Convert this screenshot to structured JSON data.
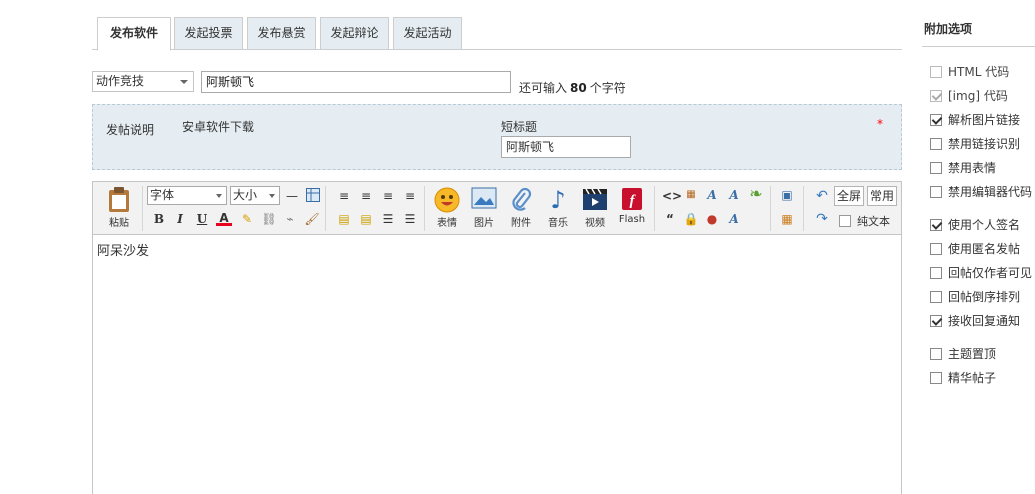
{
  "tabs": [
    {
      "label": "发布软件",
      "active": true
    },
    {
      "label": "发起投票",
      "active": false
    },
    {
      "label": "发布悬赏",
      "active": false
    },
    {
      "label": "发起辩论",
      "active": false
    },
    {
      "label": "发起活动",
      "active": false
    }
  ],
  "subject": {
    "category": "动作竞技",
    "title_value": "阿斯顿飞",
    "counter_prefix": "还可输入",
    "counter_value": "80",
    "counter_suffix": "个字符"
  },
  "info": {
    "label": "发帖说明",
    "description": "安卓软件下载",
    "short_title_label": "短标题",
    "short_title_value": "阿斯顿飞",
    "required_mark": "*"
  },
  "toolbar": {
    "paste": "粘贴",
    "font": "字体",
    "size": "大小",
    "emoticon": "表情",
    "image": "图片",
    "attachment": "附件",
    "music": "音乐",
    "video": "视频",
    "flash": "Flash",
    "fullscreen": "全屏",
    "common": "常用",
    "plaintext": "纯文本",
    "bold": "B",
    "italic": "I",
    "underline": "U",
    "fontcolor": "A"
  },
  "editor": {
    "content": "阿呆沙发"
  },
  "side": {
    "title": "附加选项",
    "options": [
      {
        "label": "HTML 代码",
        "checked": false,
        "disabled": true
      },
      {
        "label": "[img] 代码",
        "checked": true,
        "disabled": true
      },
      {
        "label": "解析图片链接",
        "checked": true,
        "disabled": false
      },
      {
        "label": "禁用链接识别",
        "checked": false,
        "disabled": false
      },
      {
        "label": "禁用表情",
        "checked": false,
        "disabled": false
      },
      {
        "label": "禁用编辑器代码",
        "checked": false,
        "disabled": false
      },
      {
        "label": "使用个人签名",
        "checked": true,
        "disabled": false
      },
      {
        "label": "使用匿名发帖",
        "checked": false,
        "disabled": false
      },
      {
        "label": "回帖仅作者可见",
        "checked": false,
        "disabled": false
      },
      {
        "label": "回帖倒序排列",
        "checked": false,
        "disabled": false
      },
      {
        "label": "接收回复通知",
        "checked": true,
        "disabled": false
      },
      {
        "label": "主题置顶",
        "checked": false,
        "disabled": false
      },
      {
        "label": "精华帖子",
        "checked": false,
        "disabled": false
      }
    ]
  },
  "colors": {
    "tab_bg": "#e5edf2",
    "info_bg": "#e5edf2",
    "required": "#ff0000"
  }
}
